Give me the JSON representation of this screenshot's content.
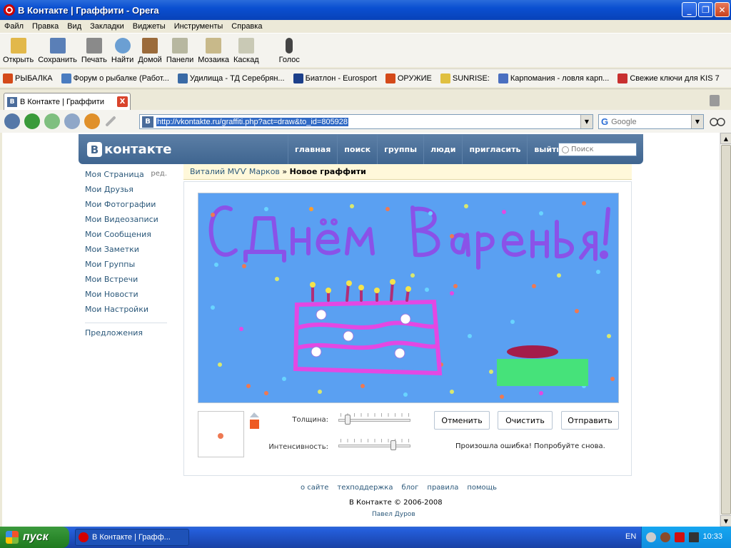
{
  "window": {
    "title": "В Контакте  |  Граффити - Opera"
  },
  "menu": [
    "Файл",
    "Правка",
    "Вид",
    "Закладки",
    "Виджеты",
    "Инструменты",
    "Справка"
  ],
  "toolbar": [
    {
      "label": "Открыть",
      "icon": "folder-open-icon",
      "color": "#e2b84a"
    },
    {
      "label": "Сохранить",
      "icon": "floppy-save-icon",
      "color": "#5a7fb7"
    },
    {
      "label": "Печать",
      "icon": "printer-icon",
      "color": "#8a8a8a"
    },
    {
      "label": "Найти",
      "icon": "magnifier-icon",
      "color": "#6b9fd3"
    },
    {
      "label": "Домой",
      "icon": "home-icon",
      "color": "#9b6b3b"
    },
    {
      "label": "Панели",
      "icon": "panels-icon",
      "color": "#b7b7a0"
    },
    {
      "label": "Мозаика",
      "icon": "tile-icon",
      "color": "#c8b98a"
    },
    {
      "label": "Каскад",
      "icon": "cascade-icon",
      "color": "#c9c9b5"
    },
    {
      "label": "Голос",
      "icon": "voice-icon",
      "color": "#444444"
    }
  ],
  "bookmarks": [
    {
      "label": "РЫБАЛКА",
      "icon": "ru-flag-icon",
      "color": "#d44a1a"
    },
    {
      "label": "Форум о рыбалке (Работ...",
      "icon": "check-icon",
      "color": "#4a7cc0"
    },
    {
      "label": "Удилища - ТД Серебрян...",
      "icon": "site-icon",
      "color": "#3a6aa6"
    },
    {
      "label": "Биатлон - Eurosport",
      "icon": "eurosport-icon",
      "color": "#1c3f8a"
    },
    {
      "label": "ОРУЖИЕ",
      "icon": "ru-flag-icon",
      "color": "#d44a1a"
    },
    {
      "label": "SUNRISE:",
      "icon": "page-icon",
      "color": "#e0c040"
    },
    {
      "label": "Карпомания - ловля карп...",
      "icon": "fish-icon",
      "color": "#4a6fc0"
    },
    {
      "label": "Свежие ключи для KIS 7",
      "icon": "key-icon",
      "color": "#c83030"
    }
  ],
  "tab": {
    "label": "В Контакте | Граффити",
    "close": "X"
  },
  "address": {
    "url": "http://vkontakte.ru/graffiti.php?act=draw&to_id=805928",
    "search_placeholder": "Google"
  },
  "vk": {
    "logo_letter": "В",
    "logo_text": "контакте",
    "nav": [
      "главная",
      "поиск",
      "группы",
      "люди",
      "пригласить",
      "выйти"
    ],
    "search_placeholder": "Поиск",
    "left_menu": [
      "Моя Страница",
      "Мои Друзья",
      "Мои Фотографии",
      "Мои Видеозаписи",
      "Мои Сообщения",
      "Мои Заметки",
      "Мои Группы",
      "Мои Встречи",
      "Мои Новости",
      "Мои Настройки"
    ],
    "edit_label": "ред.",
    "suggestions": "Предложения",
    "breadcrumb": {
      "user": "Виталий МѴѴ Марков",
      "sep": " » ",
      "current": "Новое граффити"
    },
    "graffiti": {
      "background": "#5aa0f2",
      "text": "С Днём Варенья!",
      "text_color": "#8a52e8",
      "cake_color": "#e348e3"
    },
    "controls": {
      "thickness_label": "Толщина:",
      "intensity_label": "Интенсивность:",
      "thickness_value": 0.1,
      "intensity_value": 0.78,
      "brush_color": "#ee5a22",
      "cancel": "Отменить",
      "clear": "Очистить",
      "send": "Отправить",
      "error": "Произошла ошибка! Попробуйте снова."
    },
    "footer": {
      "links": [
        "о сайте",
        "техподдержка",
        "блог",
        "правила",
        "помощь"
      ],
      "copyright": "В Контакте © 2006-2008",
      "author": "Павел Дуров"
    }
  },
  "taskbar": {
    "start": "пуск",
    "task": "В Контакте | Графф...",
    "lang": "EN",
    "clock": "10:33"
  }
}
